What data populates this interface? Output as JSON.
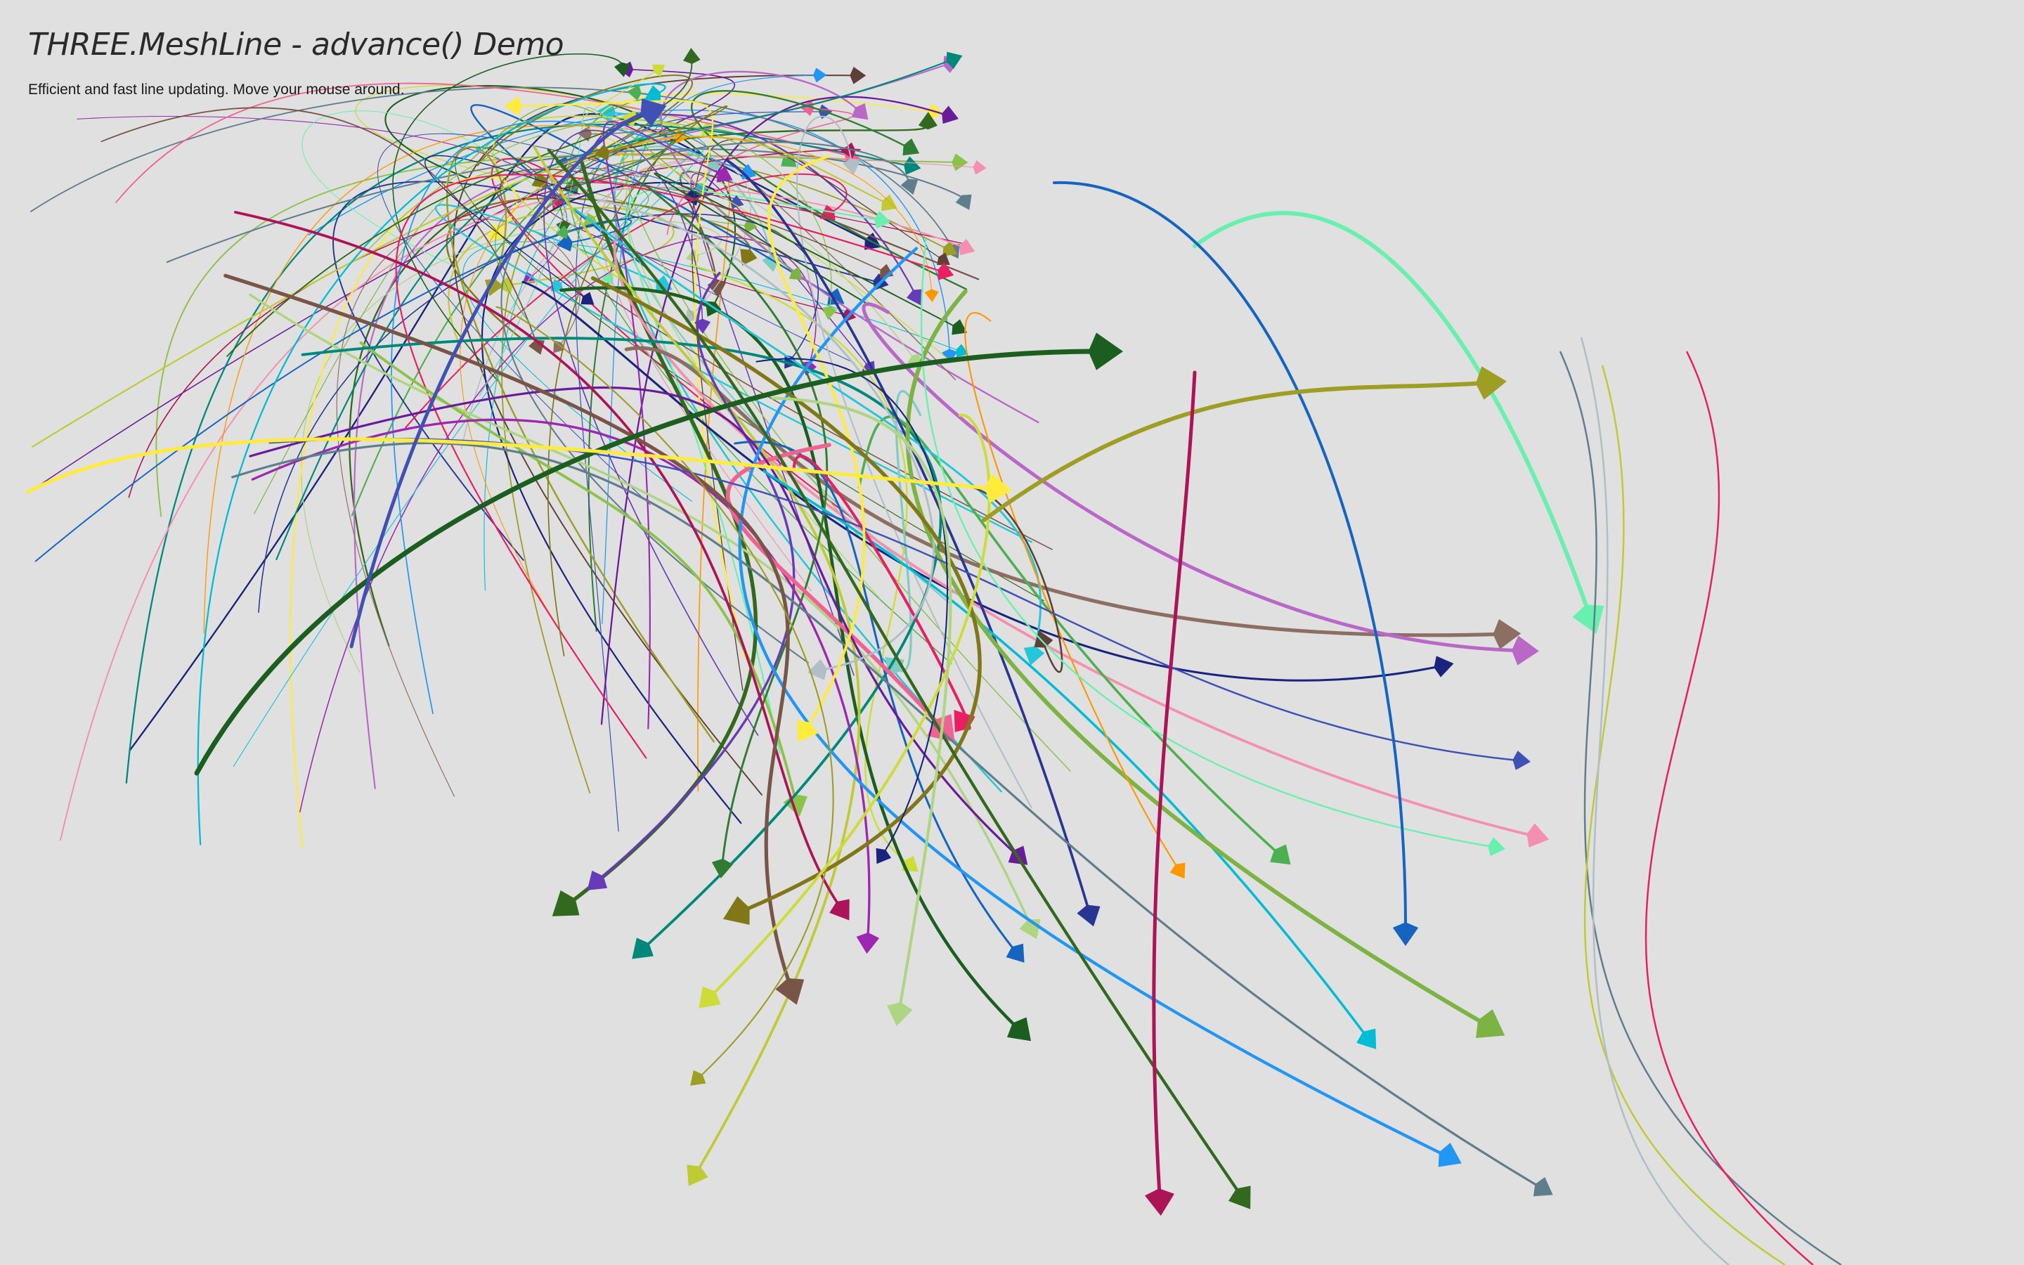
{
  "demo": {
    "title": "THREE.MeshLine - advance() Demo",
    "subtitle": "Efficient and fast line updating. Move your mouse around.",
    "background": "#e0e0e0"
  },
  "palette": [
    "#1a237e",
    "#3f51b5",
    "#2196f3",
    "#00bcd4",
    "#26c6da",
    "#4caf50",
    "#8bc34a",
    "#cddc39",
    "#ffeb3b",
    "#ff9800",
    "#e91e63",
    "#9c27b0",
    "#673ab7",
    "#1b5e20",
    "#33691e",
    "#827717",
    "#795548",
    "#607d8b",
    "#f06292",
    "#ba68c8",
    "#80cbc4",
    "#aed581",
    "#9e9d24",
    "#5d4037",
    "#ad1457",
    "#6a1b9a",
    "#2e7d32",
    "#00897b",
    "#f48fb1",
    "#69f0ae",
    "#b0bec5",
    "#7cb342",
    "#283593",
    "#1565c0",
    "#c0ca33",
    "#8d6e63"
  ]
}
